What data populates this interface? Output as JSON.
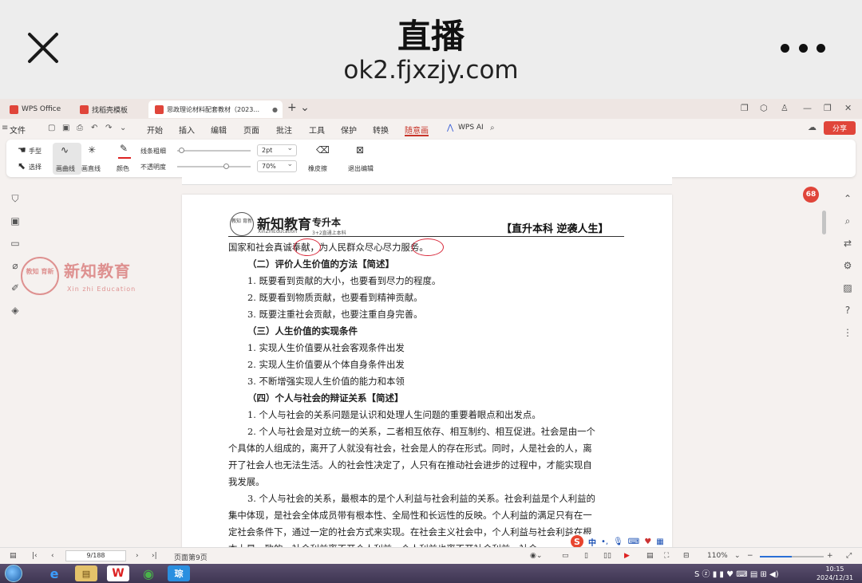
{
  "phone": {
    "title": "直播",
    "url": "ok2.fjxzjy.com"
  },
  "tabs": [
    {
      "label": "WPS Office",
      "color": "#e0453a"
    },
    {
      "label": "找稻壳模板",
      "color": "#e0453a"
    },
    {
      "label": "思政理论材料配套教材（2023...",
      "color": "#e0453a"
    }
  ],
  "menu": {
    "file": "文件",
    "items": [
      "开始",
      "插入",
      "编辑",
      "页面",
      "批注",
      "工具",
      "保护",
      "转换",
      "随意画"
    ],
    "wps_ai": "WPS AI",
    "share": "分享"
  },
  "toolbar": {
    "hand": "手型",
    "select": "选择",
    "curve": "画曲线",
    "line": "画直线",
    "color": "颜色",
    "thickness_label": "线条粗细",
    "thickness_value": "2pt",
    "opacity_label": "不透明度",
    "opacity_value": "70%",
    "eraser": "橡皮擦",
    "exit_edit": "退出编辑"
  },
  "watermark": {
    "seal": "教知 育新",
    "name": "新知教育",
    "en": "Xin zhi Education"
  },
  "badge": "68",
  "document": {
    "logo": "教知 育新",
    "brand": "新知教育",
    "brand_sub": "专升本",
    "brand_en": "XinZhiEducation",
    "brand_en2": "3+2直通上本科",
    "slogan": "【直升本科  逆袭人生】",
    "lines": [
      "国家和社会真诚奉献，为人民群众尽心尽力服务。",
      "（二）评价人生价值的方法【简述】",
      "1. 既要看到贡献的大小，也要看到尽力的程度。",
      "2. 既要看到物质贡献，也要看到精神贡献。",
      "3. 既要注重社会贡献，也要注重自身完善。",
      "（三）人生价值的实现条件",
      "1. 实现人生价值要从社会客观条件出发",
      "2. 实现人生价值要从个体自身条件出发",
      "3. 不断增强实现人生价值的能力和本领",
      "（四）个人与社会的辩证关系【简述】",
      "1. 个人与社会的关系问题是认识和处理人生问题的重要着眼点和出发点。",
      "2. 个人与社会是对立统一的关系，二者相互依存、相互制约、相互促进。社会是由一个",
      "个具体的人组成的，离开了人就没有社会，社会是人的存在形式。同时，人是社会的人，离",
      "开了社会人也无法生活。人的社会性决定了，人只有在推动社会进步的过程中，才能实现自",
      "我发展。",
      "3. 个人与社会的关系，最根本的是个人利益与社会利益的关系。社会利益是个人利益的",
      "集中体现，是社会全体成员带有根本性、全局性和长远性的反映。个人利益的满足只有在一",
      "定社会条件下，通过一定的社会方式来实现。在社会主义社会中，个人利益与社会利益在根",
      "本上是一致的，社会利益离不开个人利益，个人利益也离不开社会利益。社会..."
    ]
  },
  "ime": {
    "logo": "S",
    "mode": "中"
  },
  "statusbar": {
    "page_input": "9/188",
    "page_label": "页面第9页",
    "zoom": "110%"
  },
  "taskbar": {
    "apps": [
      "e",
      "▤",
      "W",
      "◉",
      "琮"
    ],
    "clock_time": "10:15",
    "clock_date": "2024/12/31"
  }
}
